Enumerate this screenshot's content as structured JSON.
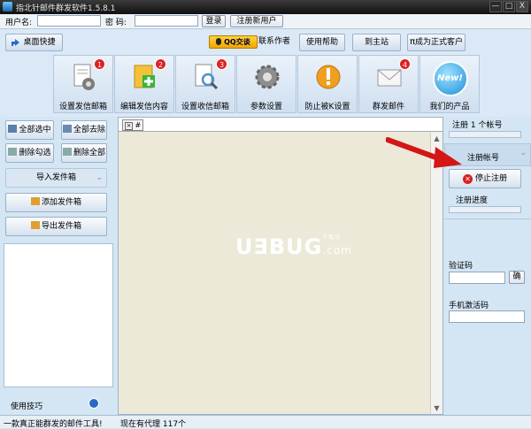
{
  "window": {
    "title": "指北针邮件群发软件1.5.8.1",
    "min": "—",
    "max": "□",
    "close": "X"
  },
  "login": {
    "username_label": "用户名:",
    "password_label": "密  码:",
    "username_value": "",
    "password_value": "",
    "login_button": "登录",
    "register_button": "注册新用户"
  },
  "topbar": {
    "desktop_shortcut": "桌面快捷",
    "qq_badge": "QQ交谈",
    "contact_author": "联系作者",
    "help": "使用帮助",
    "main_site": "到主站",
    "become_customer": "成为正式客户",
    "pi_symbol": "π"
  },
  "tools": [
    {
      "label": "设置发信邮箱",
      "badge": "1"
    },
    {
      "label": "编辑发信内容",
      "badge": "2"
    },
    {
      "label": "设置收信邮箱",
      "badge": "3"
    },
    {
      "label": "参数设置",
      "badge": ""
    },
    {
      "label": "防止被K设置",
      "badge": ""
    },
    {
      "label": "群发邮件",
      "badge": "4"
    },
    {
      "label": "我们的产品",
      "badge": "",
      "new_text": "New!"
    }
  ],
  "left": {
    "select_all": "全部选中",
    "remove_all": "全部去除",
    "delete_checked": "删除勾选",
    "delete_all": "删除全部",
    "import_outbox": "导入发件箱",
    "add_outbox": "添加发件箱",
    "export_outbox": "导出发件箱",
    "tips_label": "使用技巧",
    "import_arrow": "⌄"
  },
  "center": {
    "tab_close": "×",
    "tab_label": "#",
    "watermark_main": "U∃BUG",
    "watermark_sub": ".com",
    "watermark_tag": "下载站"
  },
  "right": {
    "register_count": "注册 1 个帐号",
    "register_account": "注册帐号",
    "stop_register": "停止注册",
    "register_progress": "注册进度",
    "captcha_label": "验证码",
    "confirm": "确",
    "sms_label": "手机激活码",
    "captcha_value": "",
    "sms_value": ""
  },
  "status": {
    "left": "一款真正能群发的邮件工具!",
    "proxy": "现在有代理 117个"
  }
}
